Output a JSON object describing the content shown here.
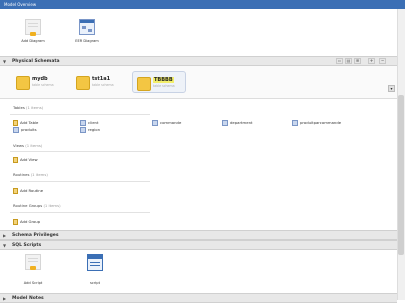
{
  "window": {
    "title": "Model Overview"
  },
  "diagrams": {
    "add_label": "Add Diagram",
    "eer_label": "EER Diagram"
  },
  "sections": {
    "physical_schemata": "Physical Schemata",
    "schema_privileges": "Schema Privileges",
    "sql_scripts": "SQL Scripts",
    "model_notes": "Model Notes"
  },
  "schemas": [
    {
      "name": "mydb",
      "sub": "table schema"
    },
    {
      "name": "tst1a1",
      "sub": "table schema"
    },
    {
      "name": "TBBBB",
      "sub": "table schema"
    }
  ],
  "tables": {
    "heading": "Tables",
    "count": "(1 items)",
    "add_label": "Add Table",
    "items": [
      "client",
      "commande",
      "department",
      "produitparcommande",
      "produits",
      "region"
    ]
  },
  "views": {
    "heading": "Views",
    "count": "(1 items)",
    "add_label": "Add View"
  },
  "routines": {
    "heading": "Routines",
    "count": "(1 items)",
    "add_label": "Add Routine"
  },
  "routine_groups": {
    "heading": "Routine Groups",
    "count": "(1 items)",
    "add_label": "Add Group"
  },
  "scripts": {
    "add_label": "Add Script",
    "script_label": "script"
  },
  "colors": {
    "titlebar": "#3b6fb5",
    "section_bg": "#e8e8e8",
    "selected_schema": "#f2ee6a"
  }
}
